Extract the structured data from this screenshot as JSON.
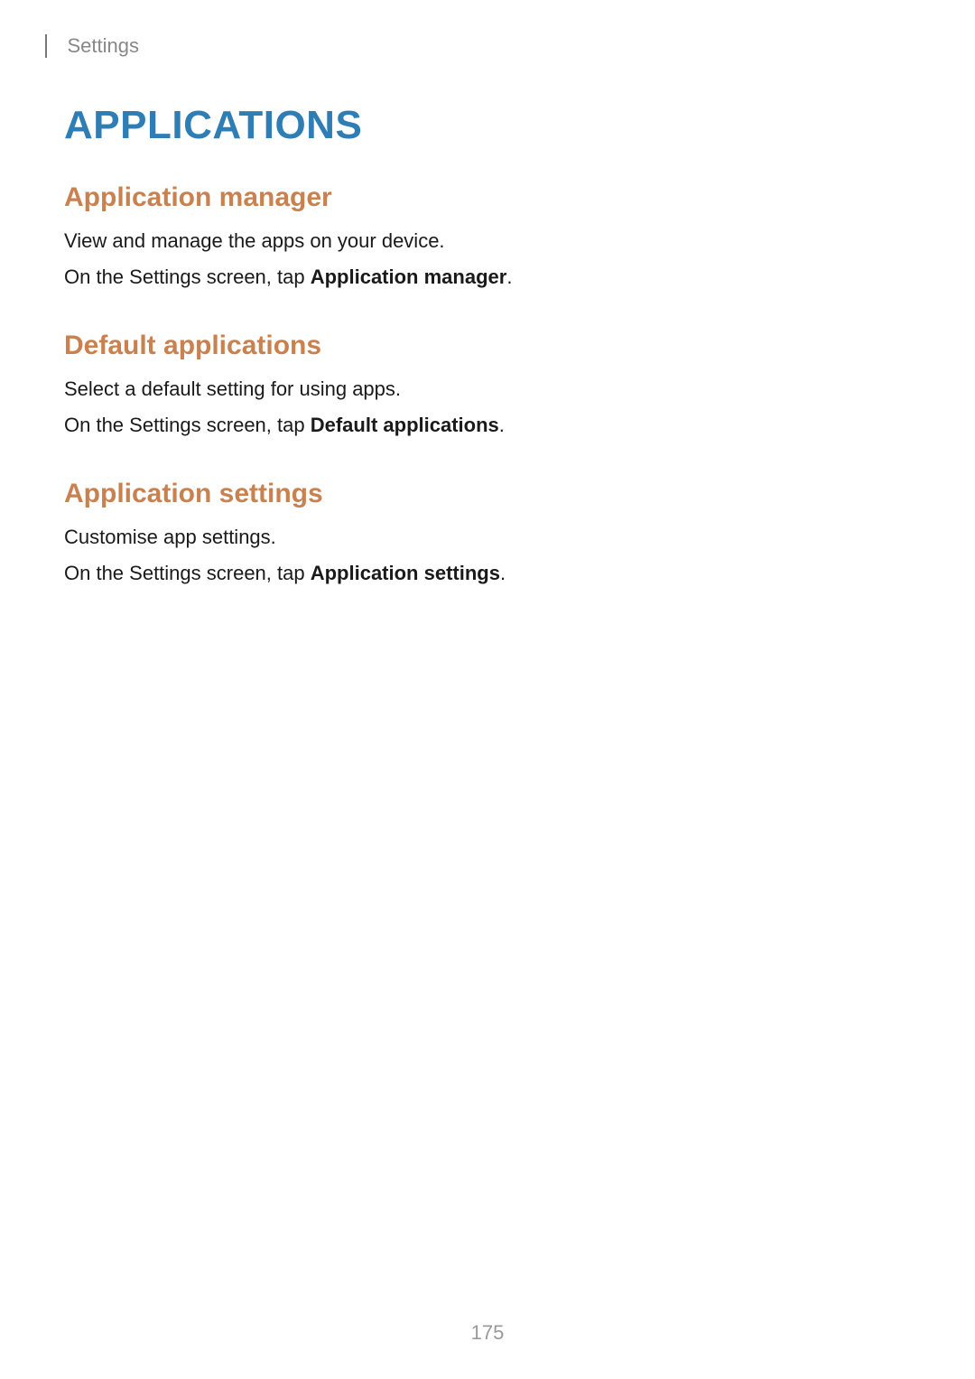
{
  "header": {
    "breadcrumb": "Settings"
  },
  "title": "APPLICATIONS",
  "sections": [
    {
      "heading": "Application manager",
      "line1": "View and manage the apps on your device.",
      "line2_prefix": "On the Settings screen, tap ",
      "line2_bold": "Application manager",
      "line2_suffix": "."
    },
    {
      "heading": "Default applications",
      "line1": "Select a default setting for using apps.",
      "line2_prefix": "On the Settings screen, tap ",
      "line2_bold": "Default applications",
      "line2_suffix": "."
    },
    {
      "heading": "Application settings",
      "line1": "Customise app settings.",
      "line2_prefix": "On the Settings screen, tap ",
      "line2_bold": "Application settings",
      "line2_suffix": "."
    }
  ],
  "pageNumber": "175"
}
